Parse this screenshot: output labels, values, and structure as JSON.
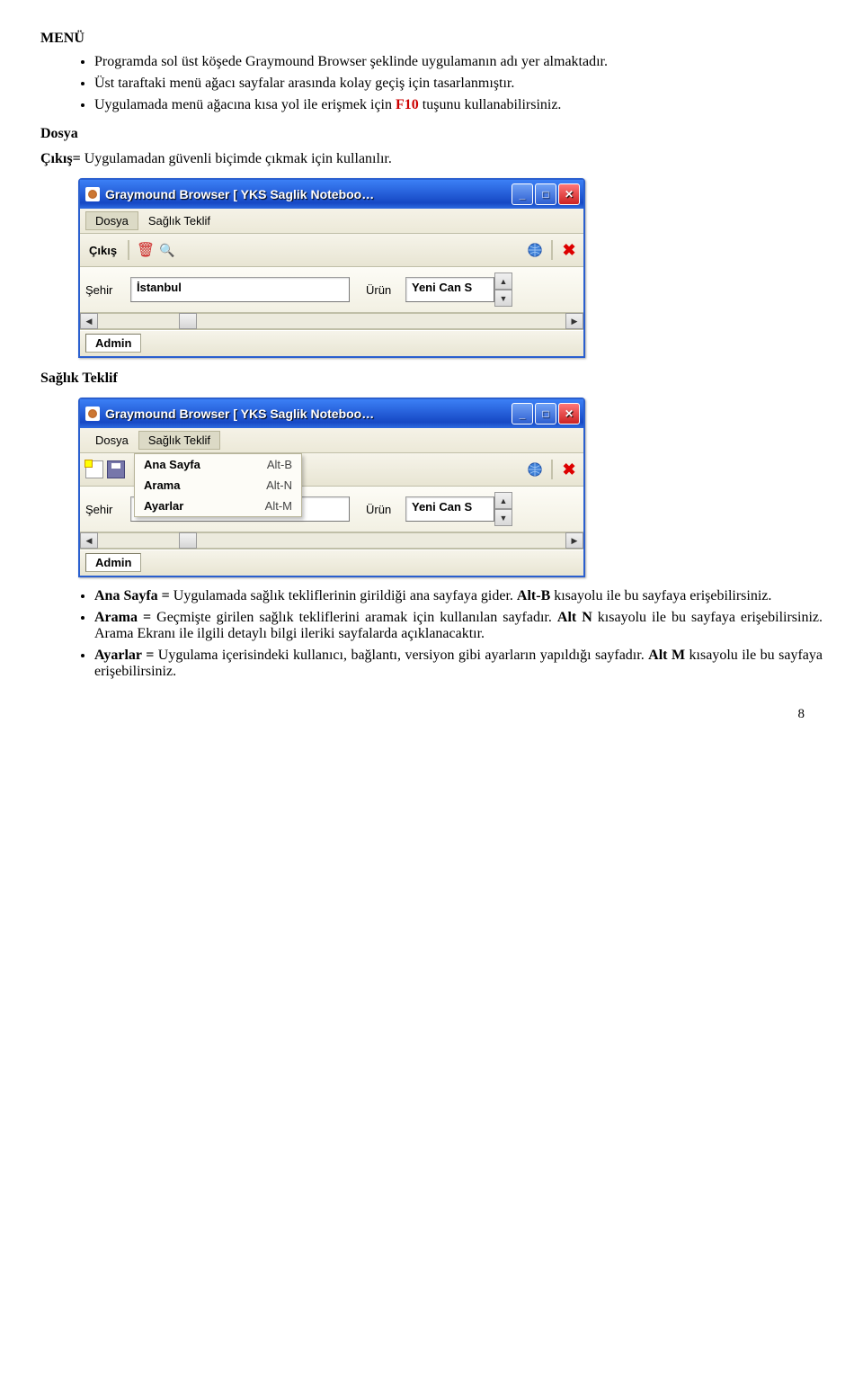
{
  "headings": {
    "menu": "MENÜ",
    "dosya": "Dosya",
    "saglik_teklif": "Sağlık Teklif"
  },
  "bullets_top": {
    "b1": "Programda sol üst köşede Graymound Browser şeklinde uygulamanın adı yer almaktadır.",
    "b2": "Üst taraftaki menü ağacı sayfalar arasında kolay geçiş için tasarlanmıştır.",
    "b3_pre": "Uygulamada menü ağacına kısa yol ile erişmek için ",
    "b3_key": "F10",
    "b3_post": " tuşunu kullanabilirsiniz."
  },
  "cikis_line_pre": "Çıkış=",
  "cikis_line_rest": " Uygulamadan güvenli biçimde çıkmak için kullanılır.",
  "app_title": "Graymound Browser [ YKS Saglik Noteboo…",
  "menus": {
    "dosya": "Dosya",
    "saglik": "Sağlık Teklif"
  },
  "toolbar_cikis": "Çıkış",
  "city_label": "Şehir",
  "city_value": "İstanbul",
  "urun_label": "Ürün",
  "urun_value": "Yeni Can S",
  "admin": "Admin",
  "dd2_items": {
    "anasayfa": {
      "label": "Ana Sayfa",
      "shortcut": "Alt-B"
    },
    "arama": {
      "label": "Arama",
      "shortcut": "Alt-N"
    },
    "ayarlar": {
      "label": "Ayarlar",
      "shortcut": "Alt-M"
    }
  },
  "bottom_bullets": {
    "b1_pre": "Ana Sayfa =",
    "b1_mid": " Uygulamada sağlık tekliflerinin girildiği ana sayfaya gider. ",
    "b1_key": "Alt-B",
    "b1_post": " kısayolu ile bu sayfaya erişebilirsiniz.",
    "b2_pre": "Arama =",
    "b2_mid": " Geçmişte girilen sağlık tekliflerini aramak için kullanılan sayfadır. ",
    "b2_key": "Alt N",
    "b2_mid2": " kısayolu ile bu sayfaya erişebilirsiniz. Arama Ekranı ile ilgili detaylı bilgi ileriki sayfalarda açıklanacaktır.",
    "b3_pre": "Ayarlar =",
    "b3_mid": " Uygulama içerisindeki kullanıcı, bağlantı, versiyon gibi ayarların yapıldığı sayfadır. ",
    "b3_key": "Alt M",
    "b3_post": " kısayolu ile bu sayfaya erişebilirsiniz."
  },
  "page_number": "8"
}
